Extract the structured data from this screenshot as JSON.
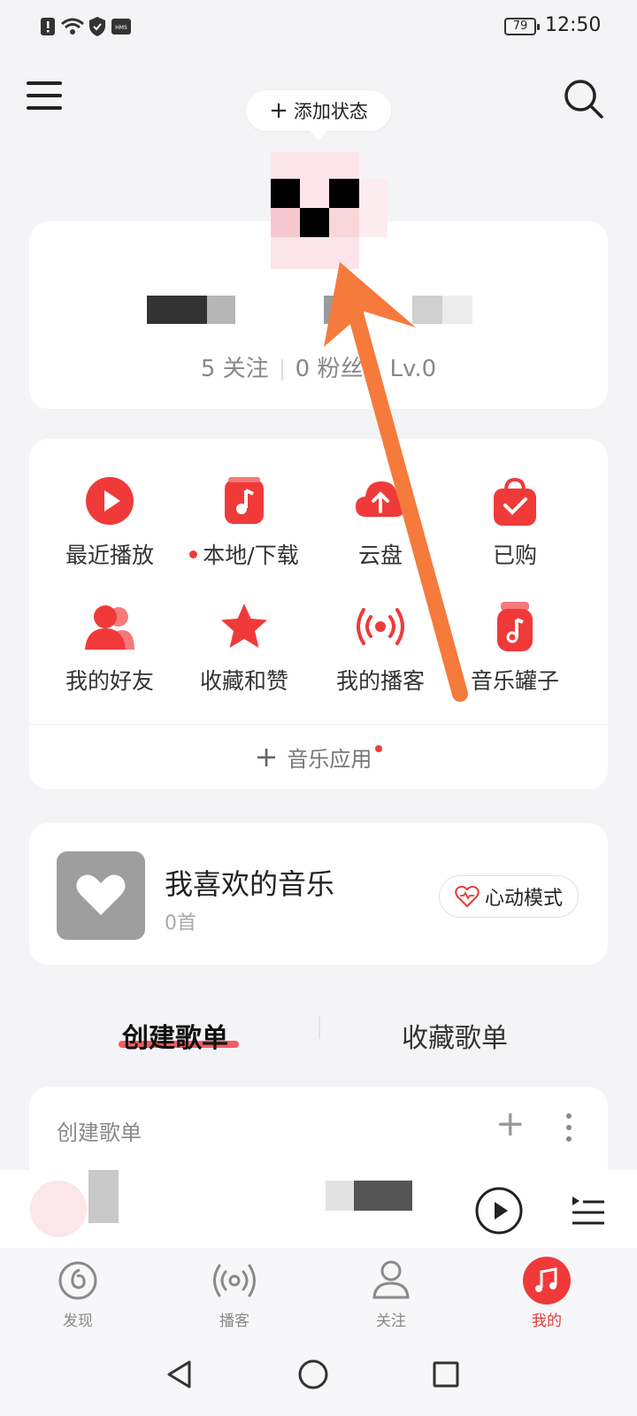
{
  "status_bar": {
    "time": "12:50",
    "battery": "79"
  },
  "header": {
    "status_button": "添加状态"
  },
  "profile": {
    "follow_label": "5 关注",
    "fans_label": "0 粉丝",
    "level_label": "Lv.0"
  },
  "grid": {
    "items": [
      {
        "label": "最近播放",
        "icon": "recent-play-icon",
        "dot": false
      },
      {
        "label": "本地/下载",
        "icon": "local-download-icon",
        "dot": true
      },
      {
        "label": "云盘",
        "icon": "cloud-upload-icon",
        "dot": false
      },
      {
        "label": "已购",
        "icon": "purchased-bag-icon",
        "dot": false
      },
      {
        "label": "我的好友",
        "icon": "friends-icon",
        "dot": false
      },
      {
        "label": "收藏和赞",
        "icon": "star-icon",
        "dot": false
      },
      {
        "label": "我的播客",
        "icon": "podcast-icon",
        "dot": false
      },
      {
        "label": "音乐罐子",
        "icon": "music-jar-icon",
        "dot": false
      }
    ],
    "music_apps": "音乐应用"
  },
  "liked": {
    "title": "我喜欢的音乐",
    "count": "0首",
    "mode_button": "心动模式"
  },
  "tabs": {
    "created": "创建歌单",
    "collected": "收藏歌单"
  },
  "playlist_section": {
    "label": "创建歌单"
  },
  "bottom_nav": {
    "items": [
      {
        "label": "发现",
        "active": false
      },
      {
        "label": "播客",
        "active": false
      },
      {
        "label": "关注",
        "active": false
      },
      {
        "label": "我的",
        "active": true
      }
    ]
  },
  "colors": {
    "accent": "#f03a3a",
    "arrow": "#f57a3c"
  }
}
